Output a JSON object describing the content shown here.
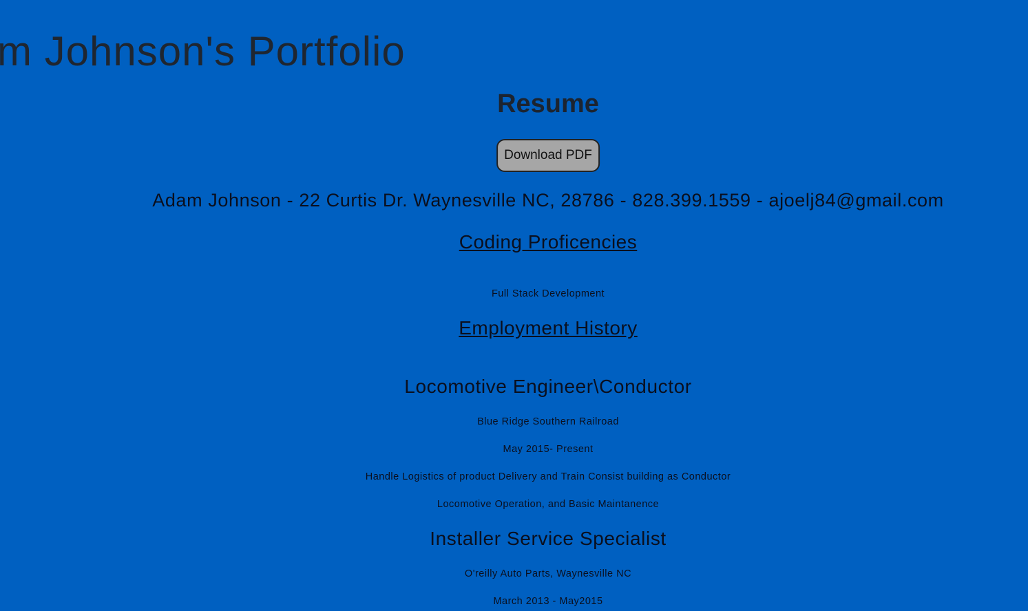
{
  "header": {
    "title": "m Johnson's Portfolio"
  },
  "resume": {
    "heading": "Resume",
    "download_label": "Download PDF",
    "contact": "Adam Johnson - 22 Curtis Dr. Waynesville NC, 28786 - 828.399.1559 - ajoelj84@gmail.com",
    "coding": {
      "heading": "Coding Proficencies",
      "items": [
        "Full Stack Development"
      ]
    },
    "employment": {
      "heading": "Employment History",
      "jobs": [
        {
          "title": "Locomotive Engineer\\Conductor",
          "company": "Blue Ridge Southern Railroad",
          "dates": "May 2015- Present",
          "duties": [
            "Handle Logistics of product Delivery and Train Consist building as Conductor",
            "Locomotive Operation, and Basic Maintanence"
          ]
        },
        {
          "title": "Installer Service Specialist",
          "company": "O'reilly Auto Parts, Waynesville NC",
          "dates": "March 2013 - May2015"
        }
      ]
    }
  },
  "colors": {
    "background": "#0060c1",
    "text": "#0a0f1e",
    "button": "#a6a6a6"
  }
}
